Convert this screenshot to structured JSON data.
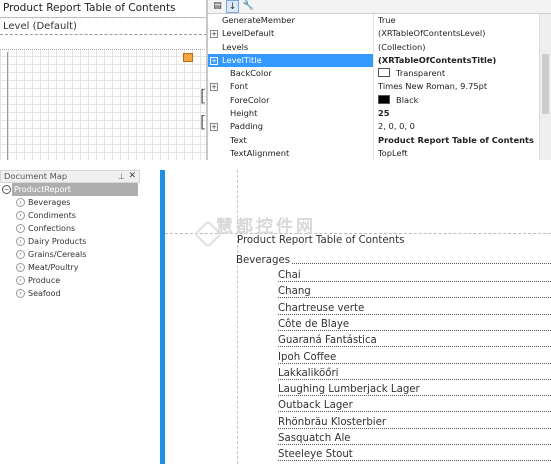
{
  "designer": {
    "title_text": "Product Report Table of Contents",
    "level_text": "Level  (Default)"
  },
  "property_grid": {
    "toolbar": {
      "categorized_icon": "categorized-icon",
      "alphabetical_icon": "alphabetical-icon",
      "properties_icon": "wrench-icon"
    },
    "rows": [
      {
        "name": "GenerateMember",
        "value": "True"
      },
      {
        "name": "LevelDefault",
        "value": "(XRTableOfContentsLevel)",
        "expandable": true
      },
      {
        "name": "Levels",
        "value": "(Collection)"
      },
      {
        "name": "LevelTitle",
        "value": "(XRTableOfContentsTitle)",
        "expandable": true,
        "selected": true,
        "bold_value": true
      },
      {
        "name": "BackColor",
        "value": "Transparent",
        "child": true,
        "swatch": "#ffffff"
      },
      {
        "name": "Font",
        "value": "Times New Roman, 9.75pt",
        "child": true,
        "expandable": true
      },
      {
        "name": "ForeColor",
        "value": "Black",
        "child": true,
        "swatch": "#000000"
      },
      {
        "name": "Height",
        "value": "25",
        "child": true,
        "bold_value": true
      },
      {
        "name": "Padding",
        "value": "2, 0, 0, 0",
        "child": true,
        "expandable": true
      },
      {
        "name": "Text",
        "value": "Product Report Table of Contents",
        "child": true,
        "bold_value": true
      },
      {
        "name": "TextAlignment",
        "value": "TopLeft",
        "child": true
      }
    ]
  },
  "document_map": {
    "header": "Document Map",
    "pin_icon": "pin-icon",
    "close_icon": "close-icon",
    "root": "ProductReport",
    "items": [
      "Beverages",
      "Condiments",
      "Confections",
      "Dairy Products",
      "Grains/Cereals",
      "Meat/Poultry",
      "Produce",
      "Seafood"
    ]
  },
  "preview": {
    "watermark": "慧都控件网",
    "title": "Product Report Table of Contents",
    "category": "Beverages",
    "entries": [
      "Chai",
      "Chang",
      "Chartreuse  verte",
      "Côte  de  Blaye",
      "Guaraná  Fantástica",
      "Ipoh  Coffee",
      "Lakkaliköőri",
      "Laughing  Lumberjack  Lager",
      "Outback  Lager",
      "Rhönbräu  Klosterbier",
      "Sasquatch  Ale",
      "Steeleye  Stout"
    ],
    "accent_color": "#1e90e8"
  }
}
